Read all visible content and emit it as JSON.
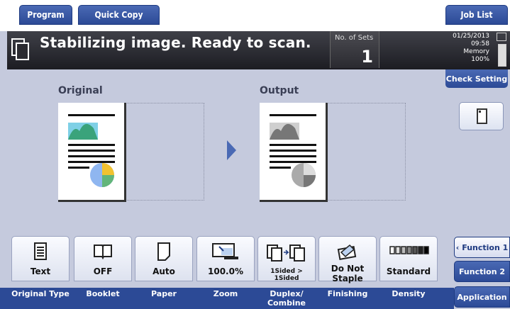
{
  "top_tabs": {
    "program": "Program",
    "quick_copy": "Quick Copy",
    "job_list": "Job List"
  },
  "status": {
    "message": "Stabilizing image. Ready to scan.",
    "sets_label": "No. of Sets",
    "sets_value": "1",
    "date": "01/25/2013",
    "time": "09:58",
    "memory_label": "Memory",
    "memory_value": "100%"
  },
  "check_setting": "Check Setting",
  "preview": {
    "original_label": "Original",
    "output_label": "Output"
  },
  "functions": [
    {
      "value": "Text",
      "caption": "Original Type",
      "icon": "document-lines-icon"
    },
    {
      "value": "OFF",
      "caption": "Booklet",
      "icon": "book-icon"
    },
    {
      "value": "Auto",
      "caption": "Paper",
      "icon": "paper-icon"
    },
    {
      "value": "100.0%",
      "caption": "Zoom",
      "icon": "zoom-icon"
    },
    {
      "value": "1Sided > 1Sided",
      "caption": "Duplex/ Combine",
      "icon": "duplex-icon"
    },
    {
      "value": "Do Not Staple",
      "caption": "Finishing",
      "icon": "staple-icon"
    },
    {
      "value": "Standard",
      "caption": "Density",
      "icon": "density-icon"
    }
  ],
  "side_tabs": {
    "function1": "Function 1",
    "function2": "Function 2",
    "application": "Application"
  },
  "colors": {
    "accent": "#2c4a96",
    "background": "#c5cadd",
    "status_bar": "#1c1c22"
  }
}
